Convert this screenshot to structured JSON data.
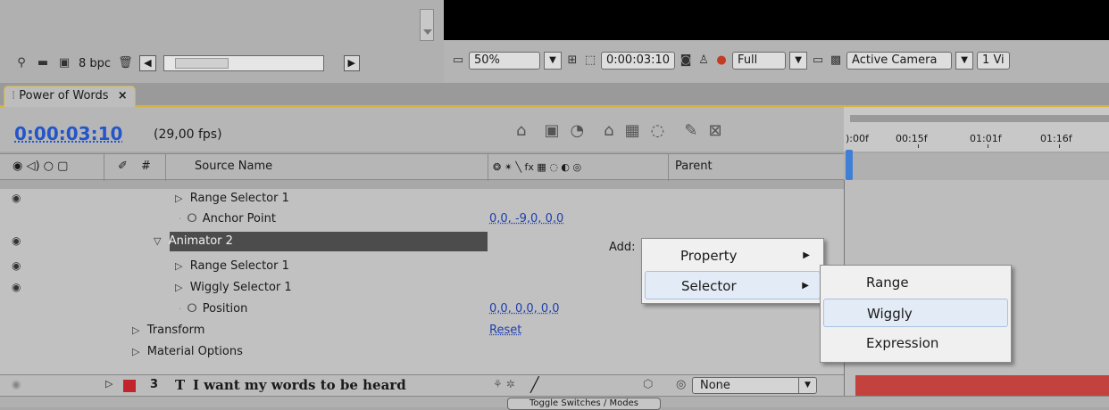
{
  "project_panel": {
    "bit_depth": "8 bpc",
    "icons": [
      "binoculars-icon",
      "folder-icon",
      "composition-icon",
      "trash-icon"
    ]
  },
  "viewer": {
    "zoom": "50%",
    "timecode": "0:00:03:10",
    "resolution": "Full",
    "camera": "Active Camera",
    "views": "1 Vi"
  },
  "tab": {
    "title": "Power of Words",
    "close": "×"
  },
  "timeline": {
    "current_time": "0:00:03:10",
    "fps": "(29,00 fps)",
    "ruler_labels": [
      "):00f",
      "00:15f",
      "01:01f",
      "01:16f"
    ],
    "columns": {
      "hash": "#",
      "source_name": "Source Name",
      "switches": "❂ ✴ ╲ fx ▦ ◌ ◐ ◎",
      "parent": "Parent"
    },
    "rows": [
      {
        "label": "Range Selector 1",
        "value": ""
      },
      {
        "label": "Anchor Point",
        "value": "0,0, -9,0, 0,0"
      },
      {
        "label": "Animator 2",
        "value": ""
      },
      {
        "label": "Range Selector 1",
        "value": ""
      },
      {
        "label": "Wiggly Selector 1",
        "value": ""
      },
      {
        "label": "Position",
        "value": "0,0, 0,0, 0,0"
      },
      {
        "label": "Transform",
        "value": "Reset"
      },
      {
        "label": "Material Options",
        "value": ""
      }
    ],
    "add_label": "Add:",
    "layer3": {
      "number": "3",
      "type_glyph": "T",
      "name": "I want my words to be heard",
      "parent_value": "None"
    },
    "toggle_label": "Toggle Switches / Modes"
  },
  "menu_add": {
    "items": [
      "Property",
      "Selector"
    ],
    "highlighted": "Selector"
  },
  "menu_selector": {
    "items": [
      "Range",
      "Wiggly",
      "Expression"
    ],
    "highlighted": "Wiggly"
  },
  "colors": {
    "timecode_blue": "#2456c8",
    "label_red": "#c2242b",
    "tab_accent": "#d6b23c",
    "cti_blue": "#3f7fd6"
  }
}
